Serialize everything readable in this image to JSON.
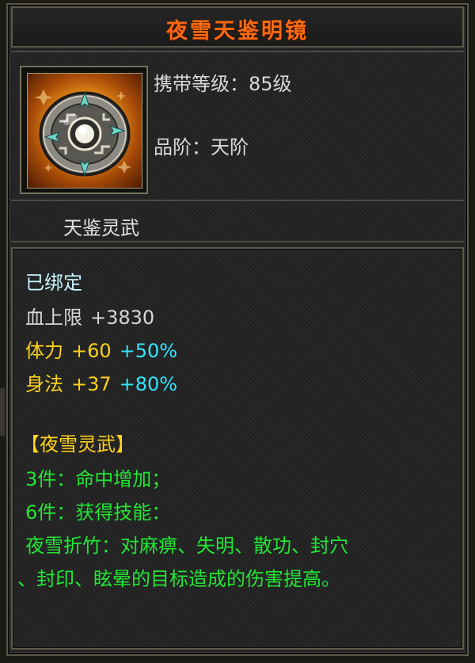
{
  "item": {
    "title": "夜雪天鉴明镜",
    "icon_name": "mirror-disc-icon",
    "carry_level": "携带等级：85级",
    "grade": "品阶：天阶",
    "category": "天鉴灵武"
  },
  "status": {
    "bound": "已绑定"
  },
  "stats": [
    {
      "label": "血上限",
      "value": "+3830",
      "percent": ""
    },
    {
      "label": "体力",
      "value": "+60",
      "percent": "+50%"
    },
    {
      "label": "身法",
      "value": "+37",
      "percent": "+80%"
    }
  ],
  "set": {
    "name": "【夜雪灵武】",
    "bonus_3": "3件：命中增加；",
    "bonus_6": "6件：获得技能：",
    "skill_line1": "夜雪折竹：对麻痹、失明、散功、封穴",
    "skill_line2": "、封印、眩晕的目标造成的伤害提高。"
  },
  "colors": {
    "title": "#ff6a10",
    "set_name": "#ffd21a",
    "set_effect": "#22e634",
    "percent": "#33e6ff",
    "bound": "#c8f4ff"
  }
}
